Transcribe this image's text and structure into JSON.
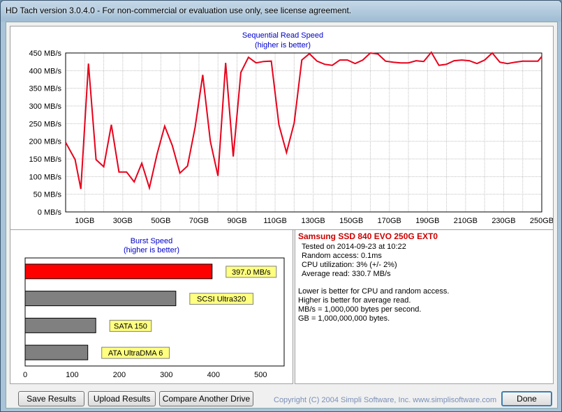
{
  "window": {
    "title": "HD Tach version 3.0.4.0  - For non-commercial or evaluation use only, see license agreement."
  },
  "sequential": {
    "title": "Sequential Read Speed",
    "subtitle": "(higher is better)"
  },
  "burst": {
    "title": "Burst Speed",
    "subtitle": "(higher is better)"
  },
  "info": {
    "drive_name": "Samsung SSD 840 EVO 250G EXT0",
    "lines": [
      "Tested on 2014-09-23 at 10:22",
      "Random access: 0.1ms",
      "CPU utilization: 3% (+/- 2%)",
      "Average read: 330.7 MB/s"
    ],
    "notes": [
      "Lower is better for CPU and random access.",
      "Higher is better for average read.",
      "MB/s = 1,000,000 bytes per second.",
      "GB = 1,000,000,000 bytes."
    ]
  },
  "buttons": {
    "save": "Save Results",
    "upload": "Upload Results",
    "compare": "Compare Another Drive",
    "done": "Done"
  },
  "footer": {
    "copyright": "Copyright (C) 2004 Simpli Software, Inc. www.simplisoftware.com"
  },
  "colors": {
    "line": "#e8001a",
    "highlight_bar": "#ff0000",
    "other_bar": "#808080",
    "label_bg": "#ffff80",
    "drive_name": "#cc0000",
    "chart_title": "#0000cc"
  },
  "chart_data": [
    {
      "type": "line",
      "title": "Sequential Read Speed",
      "subtitle": "(higher is better)",
      "xlabel": "",
      "ylabel": "",
      "xlim": [
        0,
        250
      ],
      "ylim": [
        0,
        450
      ],
      "y_ticks": [
        "0 MB/s",
        "50 MB/s",
        "100 MB/s",
        "150 MB/s",
        "200 MB/s",
        "250 MB/s",
        "300 MB/s",
        "350 MB/s",
        "400 MB/s",
        "450 MB/s"
      ],
      "x_ticks": [
        "10GB",
        "30GB",
        "50GB",
        "70GB",
        "90GB",
        "110GB",
        "130GB",
        "150GB",
        "170GB",
        "190GB",
        "210GB",
        "230GB",
        "250GB"
      ],
      "grid": true,
      "series": [
        {
          "x": [
            0,
            5,
            8,
            12,
            16,
            20,
            24,
            28,
            32,
            36,
            40,
            44,
            48,
            52,
            56,
            60,
            64,
            68,
            72,
            76,
            80,
            84,
            88,
            92,
            96,
            100,
            104,
            108,
            112,
            116,
            120,
            124,
            128,
            132,
            136,
            140,
            144,
            148,
            152,
            156,
            160,
            164,
            168,
            172,
            176,
            180,
            184,
            188,
            192,
            196,
            200,
            204,
            208,
            212,
            216,
            220,
            224,
            228,
            232,
            236,
            240,
            244,
            248,
            250
          ],
          "y": [
            197,
            148,
            65,
            420,
            148,
            128,
            247,
            113,
            113,
            85,
            138,
            68,
            163,
            243,
            188,
            110,
            130,
            240,
            388,
            200,
            102,
            422,
            157,
            395,
            438,
            422,
            426,
            427,
            247,
            168,
            252,
            430,
            448,
            427,
            418,
            415,
            430,
            430,
            420,
            430,
            450,
            447,
            427,
            424,
            422,
            422,
            428,
            426,
            452,
            415,
            418,
            428,
            430,
            428,
            420,
            430,
            450,
            424,
            420,
            424,
            427,
            427,
            427,
            440
          ]
        }
      ]
    },
    {
      "type": "bar",
      "title": "Burst Speed",
      "subtitle": "(higher is better)",
      "categories": [
        "397.0 MB/s",
        "SCSI Ultra320",
        "SATA 150",
        "ATA UltraDMA 6"
      ],
      "values": [
        397,
        320,
        150,
        133
      ],
      "xlim": [
        0,
        550
      ],
      "x_ticks": [
        "0",
        "100",
        "200",
        "300",
        "400",
        "500"
      ],
      "orientation": "horizontal"
    }
  ]
}
